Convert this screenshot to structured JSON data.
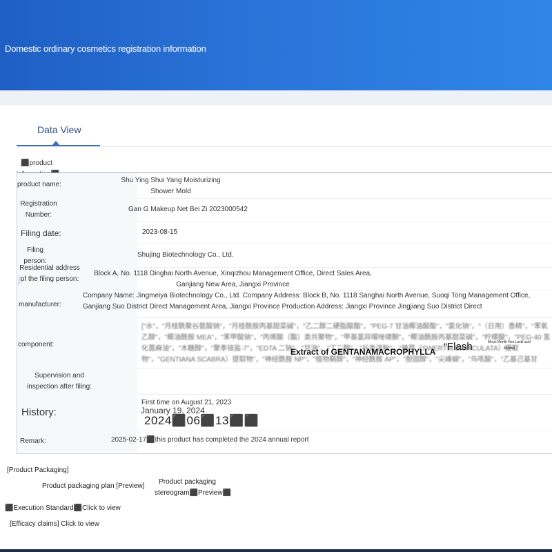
{
  "banner": {
    "title": "Domestic ordinary cosmetics registration information"
  },
  "tabs": [
    {
      "label": "Data View"
    }
  ],
  "table": {
    "section_label": "⬛product information⬛",
    "rows": {
      "product_name": {
        "label": "product name:",
        "value": "Shu Ying Shui Yang Moisturizing Shower Mold"
      },
      "registration_number": {
        "label": "Registration Number:",
        "value": "Gan G Makeup Net Bei Zi 2023000542"
      },
      "filing_date": {
        "label": "Filing date:",
        "value": "2023-08-15"
      },
      "filing_person": {
        "label": "Filing person:",
        "value": "Shujing Biotechnology Co., Ltd."
      },
      "residential_address": {
        "label": "Residential address of the filing person:",
        "value": "Block A, No. 1118 Dinghai North Avenue, Xinqizhou Management Office, Direct Sales Area, Ganjiang New Area, Jiangxi Province"
      },
      "manufacturer": {
        "label": "manufacturer:",
        "value": "Company Name: Jingmeiya Biotechnology Co., Ltd. Company Address: Block B, No. 1118 Sanghai North Avenue, Suoqi Tong Management Office, Ganjiang Suo District Direct Management Area, Jiangxi Province Production Address: Jiangxi Province Jingjiang Suo District Direct"
      },
      "component": {
        "label": "component:",
        "value": "[\"水\"，\"月桂酰聚谷氨酸钠\"，\"月桂酰胺丙基甜菜碱\"，\"乙二醇二硬脂酸酯\"，\"PEG-7 甘油椰油酸酯\"，\"氯化钠\"，\"（日用）香精\"，\"苯氧乙醇\"，\"椰油酰胺 MEA\"，\"苯甲酸钠\"，\"丙烯酸（酯）类共聚物\"，\"甲基氯异噮唑啸酮\"，\"椰油酰胺丙基甜菜碱\"，\"柠檬酸\"，\"PEG-40 氢化蓖麻油\"，\"木糖醇\"，\"聚季铵盐-7\"，\"EDTA 二钠\"，\"甘油\"，\"丁二醇\"，\"谷类淀粉\"，\"辣草（SWERTIA BIMACULATA）提取物\"，\"GENTIANA SCABRA）提取物\"，\"神经酰胺 NP\"，\"植物鞘醇\"，\"神经酰胺 AP\"，\"胆固醇\"，\"尖峰蝴\"，\"鸟啂酸\"，\"乙基己基甘油\"，\"神经酰胺 EOP\"]"
      },
      "supervision": {
        "label": "Supervision and inspection after filing:",
        "value": ""
      },
      "history": {
        "label": "History:",
        "entries": [
          "First time on August 21, 2023",
          "January 19, 2024",
          "2024⬛06⬛13⬛⬛"
        ]
      },
      "remark": {
        "label": "Remark:",
        "value": "2025-02-17⬛this product has completed the 2024 annual report"
      }
    },
    "overlays": {
      "extract": "Extract of GENTANAMACROPHYLLA",
      "quote": "“Flash",
      "small_note": "Moon Month Hon Lactil acid Alcohol"
    }
  },
  "packaging": {
    "heading": "[Product Packaging]",
    "plan": "Product packaging plan [Preview]",
    "stereogram": "Product packaging stereogram⬛Preview⬛",
    "execution_standard": "⬛Execution Standard⬛Click to view",
    "efficacy_claims": "[Efficacy claims] Click to view"
  }
}
